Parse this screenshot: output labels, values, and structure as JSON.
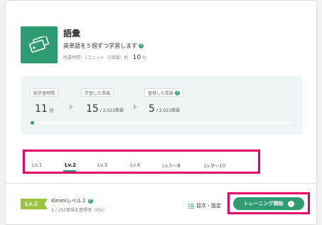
{
  "course": {
    "icon": "flashcards-icon",
    "title": "語彙",
    "description": "英単語を５個ずつ学習します",
    "time_label": "所要時間：1ユニット（5単語）約",
    "time_value": "10",
    "time_unit": "分"
  },
  "stats": {
    "total_time": {
      "label": "総学習時間",
      "value": "11",
      "unit": "分"
    },
    "learned_words": {
      "label": "学習した単語",
      "value": "15",
      "sub": "/ 2,023単語"
    },
    "mastered_words": {
      "label": "習得した単語",
      "value": "5",
      "sub": "/ 2,023単語"
    },
    "progress_fraction": 0.007
  },
  "levels": {
    "tabs": [
      "Lv.1",
      "Lv.2",
      "Lv.3",
      "Lv.4",
      "Lv.5〜8",
      "Lv.9〜10"
    ],
    "selected": "Lv.2"
  },
  "current_level": {
    "badge": "Lv.2",
    "name": "Kiminiレベル２",
    "progress": "2 / 250単語を習得済（0%）"
  },
  "toc_label": "目次・設定",
  "start_button": "トレーニング開始",
  "colors": {
    "accent": "#2e9b72",
    "badge": "#9bc33c",
    "highlight": "#e5006a"
  }
}
